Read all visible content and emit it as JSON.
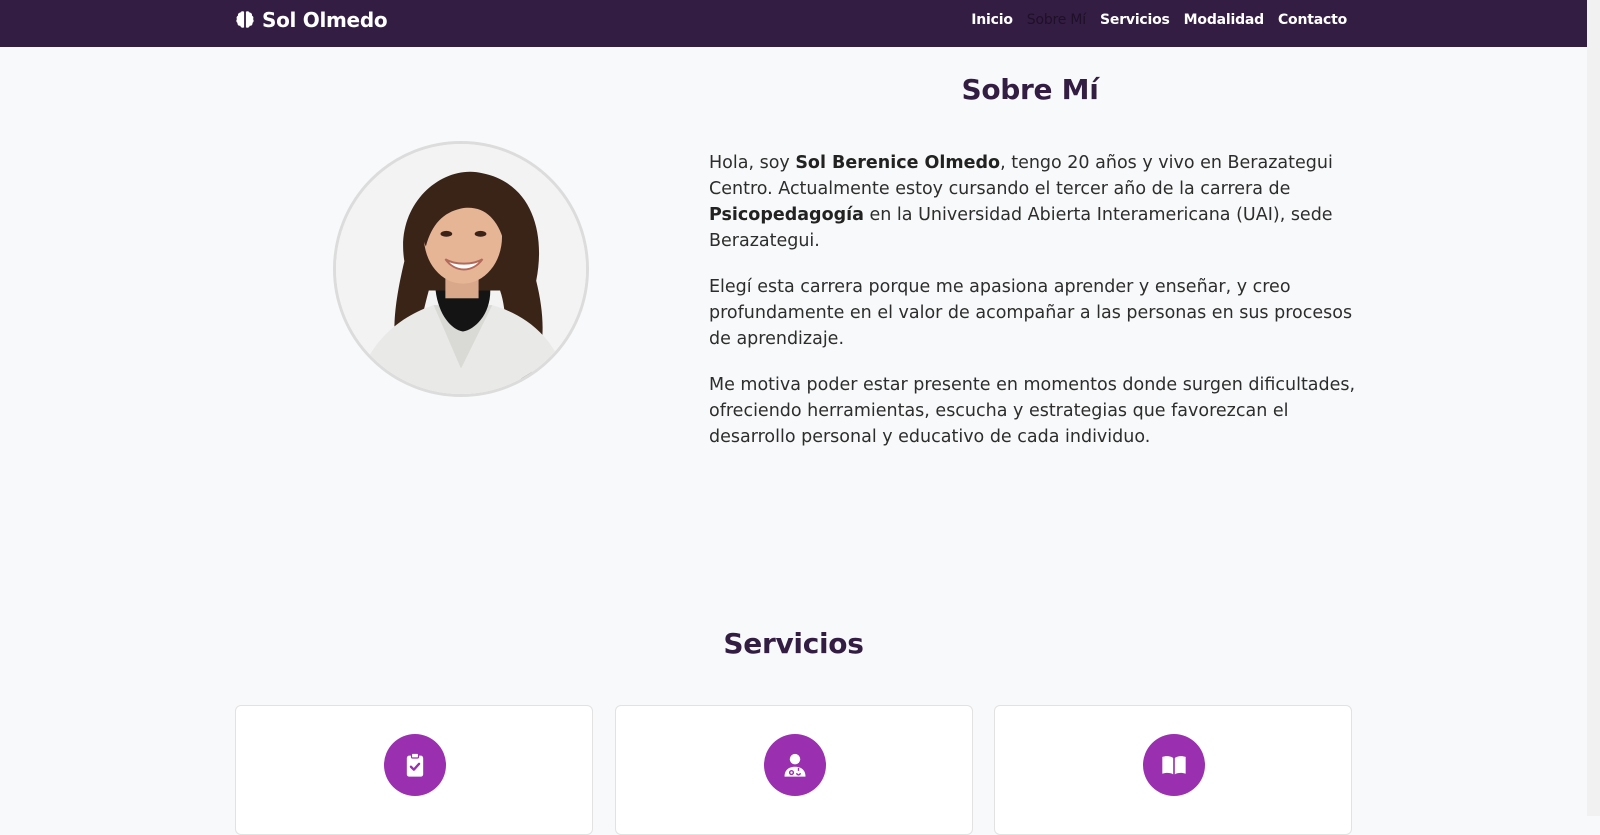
{
  "brand": {
    "name": "Sol Olmedo",
    "icon": "brain-icon"
  },
  "nav": [
    {
      "label": "Inicio",
      "active": false
    },
    {
      "label": "Sobre Mí",
      "active": true
    },
    {
      "label": "Servicios",
      "active": false
    },
    {
      "label": "Modalidad",
      "active": false
    },
    {
      "label": "Contacto",
      "active": false
    }
  ],
  "about": {
    "title": "Sobre Mí",
    "p1_a": "Hola, soy ",
    "p1_name": "Sol Berenice Olmedo",
    "p1_b": ", tengo 20 años y vivo en Berazategui Centro. Actualmente estoy cursando el tercer año de la carrera de ",
    "p1_career": "Psicopedagogía",
    "p1_c": " en la Universidad Abierta Interamericana (UAI), sede Berazategui.",
    "p2": "Elegí esta carrera porque me apasiona aprender y enseñar, y creo profundamente en el valor de acompañar a las personas en sus procesos de aprendizaje.",
    "p3": "Me motiva poder estar presente en momentos donde surgen dificultades, ofreciendo herramientas, escucha y estrategias que favorezcan el desarrollo personal y educativo de cada individuo."
  },
  "services": {
    "title": "Servicios",
    "cards": [
      {
        "icon": "clipboard-check-icon"
      },
      {
        "icon": "user-doctor-icon"
      },
      {
        "icon": "open-book-icon"
      }
    ]
  },
  "colors": {
    "navbar": "#341d42",
    "accent": "#9a2fb0",
    "title": "#341d42"
  }
}
